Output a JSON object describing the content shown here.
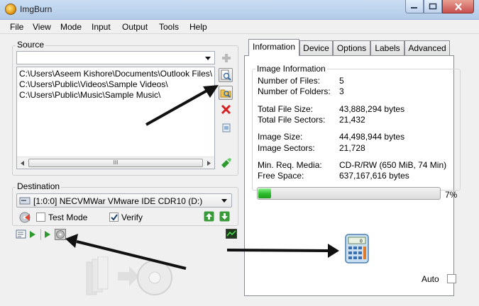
{
  "window": {
    "title": "ImgBurn"
  },
  "menu": [
    "File",
    "View",
    "Mode",
    "Input",
    "Output",
    "Tools",
    "Help"
  ],
  "source": {
    "label": "Source",
    "combo_value": "",
    "files": [
      "C:\\Users\\Aseem Kishore\\Documents\\Outlook Files\\",
      "C:\\Users\\Public\\Videos\\Sample Videos\\",
      "C:\\Users\\Public\\Music\\Sample Music\\"
    ],
    "scroll_grip": "III"
  },
  "destination": {
    "label": "Destination",
    "drive": "[1:0:0] NECVMWar VMware IDE CDR10 (D:)",
    "test_mode_label": "Test Mode",
    "test_mode_checked": false,
    "verify_label": "Verify",
    "verify_checked": true
  },
  "tabs": [
    "Information",
    "Device",
    "Options",
    "Labels",
    "Advanced"
  ],
  "active_tab": "Information",
  "information": {
    "group_label": "Image Information",
    "rows": [
      {
        "label": "Number of Files:",
        "value": "5"
      },
      {
        "label": "Number of Folders:",
        "value": "3"
      },
      {
        "label": "Total File Size:",
        "value": "43,888,294 bytes"
      },
      {
        "label": "Total File Sectors:",
        "value": "21,432"
      },
      {
        "label": "Image Size:",
        "value": "44,498,944 bytes"
      },
      {
        "label": "Image Sectors:",
        "value": "21,728"
      },
      {
        "label": "Min. Req. Media:",
        "value": "CD-R/RW (650 MiB, 74 Min)"
      },
      {
        "label": "Free Space:",
        "value": "637,167,616 bytes"
      }
    ],
    "progress_percent": 7,
    "progress_label": "7%",
    "auto_label": "Auto",
    "auto_checked": false
  },
  "icons": {
    "add": "plus-icon",
    "browse_file": "browse-file-icon",
    "browse_folder": "browse-folder-icon",
    "remove": "delete-x-icon",
    "clear": "trash-icon",
    "calculate": "calculator-icon",
    "build": "build-icon",
    "log": "log-icon"
  },
  "colors": {
    "progress": "#2fbf2f",
    "arrow": "#111111",
    "remove_red": "#d42020",
    "add_green": "#2d9a2d"
  }
}
